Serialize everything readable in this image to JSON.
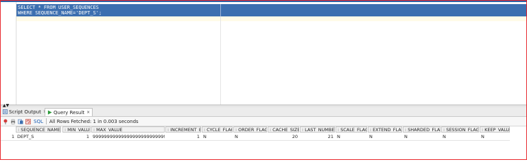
{
  "editor": {
    "line1": "SELECT * FROM USER_SEQUENCES",
    "line2": "WHERE SEQUENCE_NAME='DEPT_S';"
  },
  "tabs": [
    {
      "label": "Script Output",
      "close": "×",
      "icon": "script-output-icon"
    },
    {
      "label": "Query Result",
      "close": "×",
      "icon": "play-icon"
    }
  ],
  "toolbar": {
    "sql_label": "SQL",
    "separator": "|",
    "status": "All Rows Fetched: 1 in 0.003 seconds",
    "icons": [
      "pin-icon",
      "print-icon",
      "export-icon",
      "refresh-icon"
    ]
  },
  "grid": {
    "columns": [
      "SEQUENCE_NAME",
      "MIN_VALUE",
      "MAX_VALUE",
      "INCREMENT_BY",
      "CYCLE_FLAG",
      "ORDER_FLAG",
      "CACHE_SIZE",
      "LAST_NUMBER",
      "SCALE_FLAG",
      "EXTEND_FLAG",
      "SHARDED_FLAG",
      "SESSION_FLAG",
      "KEEP_VALUE"
    ],
    "rows": [
      {
        "row_no": "1",
        "cells": [
          "DEPT_S",
          "1",
          "9999999999999999999999999999",
          "1",
          "N",
          "N",
          "20",
          "21",
          "N",
          "N",
          "N",
          "N",
          "N"
        ]
      }
    ]
  },
  "colors": {
    "selection": "#3c6fb0",
    "border": "#e8262b",
    "link": "#1c5db3"
  }
}
